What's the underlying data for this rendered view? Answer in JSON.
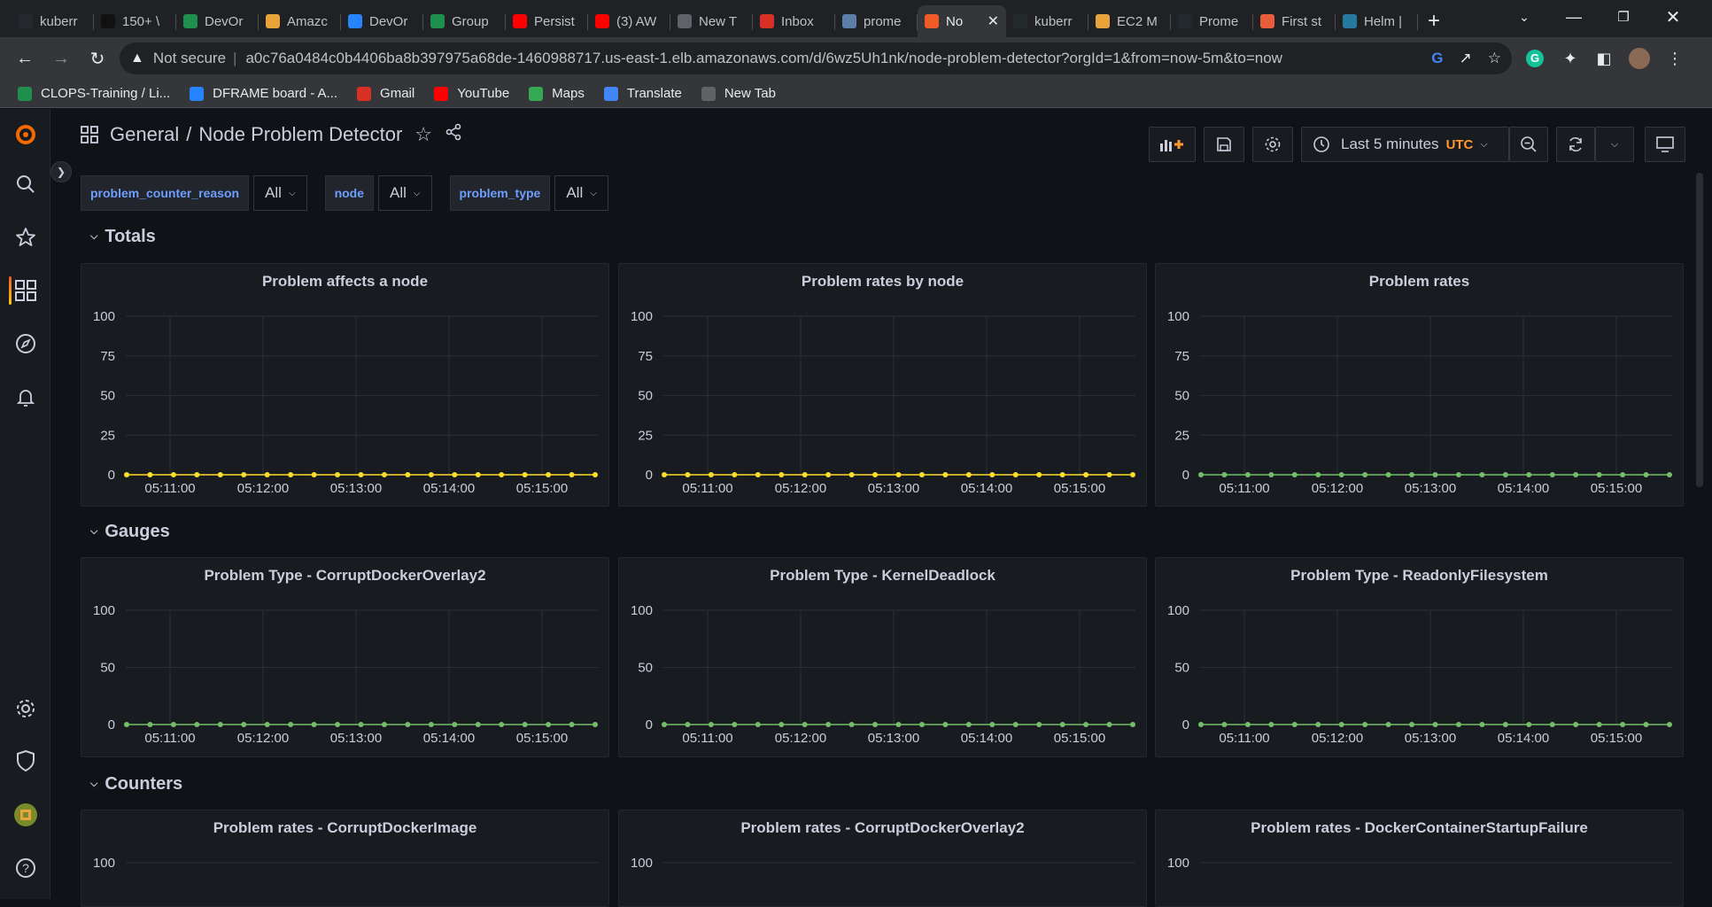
{
  "browser": {
    "tabs": [
      {
        "label": "kuberr",
        "icon": "github-icon",
        "color": "#24292e"
      },
      {
        "label": "150+ \\",
        "icon": "bb-icon",
        "color": "#111111"
      },
      {
        "label": "DevOr",
        "icon": "devops-icon",
        "color": "#1f8f4e"
      },
      {
        "label": "Amazc",
        "icon": "aws-box-icon",
        "color": "#e8a33b"
      },
      {
        "label": "DevOr",
        "icon": "jira-icon",
        "color": "#2684ff"
      },
      {
        "label": "Group",
        "icon": "devops-icon",
        "color": "#1f8f4e"
      },
      {
        "label": "Persist",
        "icon": "youtube-icon",
        "color": "#ff0000"
      },
      {
        "label": "(3) AW",
        "icon": "youtube-icon",
        "color": "#ff0000"
      },
      {
        "label": "New T",
        "icon": "chrome-icon",
        "color": "#5f6368"
      },
      {
        "label": "Inbox",
        "icon": "gmail-icon",
        "color": "#d93025"
      },
      {
        "label": "prome",
        "icon": "prometheus-icon",
        "color": "#5b7fa8"
      },
      {
        "label": "No",
        "icon": "grafana-icon",
        "color": "#f05a28",
        "active": true
      },
      {
        "label": "kuberr",
        "icon": "github-icon",
        "color": "#24292e"
      },
      {
        "label": "EC2 M",
        "icon": "aws-box-icon",
        "color": "#e8a33b"
      },
      {
        "label": "Prome",
        "icon": "github-icon",
        "color": "#24292e"
      },
      {
        "label": "First st",
        "icon": "medium-icon",
        "color": "#e85d3a"
      },
      {
        "label": "Helm |",
        "icon": "helm-icon",
        "color": "#277a9f"
      }
    ],
    "not_secure": "Not secure",
    "url": "a0c76a0484c0b4406ba8b397975a68de-1460988717.us-east-1.elb.amazonaws.com/d/6wz5Uh1nk/node-problem-detector?orgId=1&from=now-5m&to=now",
    "bookmarks": [
      {
        "label": "CLOPS-Training / Li...",
        "icon": "devops-icon",
        "color": "#1f8f4e"
      },
      {
        "label": "DFRAME board - A...",
        "icon": "jira-icon",
        "color": "#2684ff"
      },
      {
        "label": "Gmail",
        "icon": "gmail-icon",
        "color": "#d93025"
      },
      {
        "label": "YouTube",
        "icon": "youtube-icon",
        "color": "#ff0000"
      },
      {
        "label": "Maps",
        "icon": "maps-icon",
        "color": "#34a853"
      },
      {
        "label": "Translate",
        "icon": "translate-icon",
        "color": "#4285f4"
      },
      {
        "label": "New Tab",
        "icon": "chrome-icon",
        "color": "#5f6368"
      }
    ]
  },
  "dashboard": {
    "folder": "General",
    "title": "Node Problem Detector",
    "time_range": "Last 5 minutes",
    "timezone": "UTC",
    "variables": [
      {
        "name": "problem_counter_reason",
        "value": "All"
      },
      {
        "name": "node",
        "value": "All"
      },
      {
        "name": "problem_type",
        "value": "All"
      }
    ],
    "rows": [
      {
        "title": "Totals"
      },
      {
        "title": "Gauges"
      },
      {
        "title": "Counters"
      }
    ]
  },
  "colors": {
    "series_yellow": "#fade2a",
    "series_green": "#73bf69",
    "accent_blue": "#6e9fff",
    "utc_orange": "#ff9830"
  },
  "chart_data": [
    {
      "panel": "Problem affects a node",
      "type": "line",
      "x": [
        "05:11:00",
        "05:12:00",
        "05:13:00",
        "05:14:00",
        "05:15:00"
      ],
      "yticks": [
        0,
        25,
        50,
        75,
        100
      ],
      "ylim": [
        0,
        100
      ],
      "series": [
        {
          "color": "#fade2a",
          "values": [
            0,
            0,
            0,
            0,
            0,
            0,
            0,
            0,
            0,
            0,
            0,
            0,
            0,
            0,
            0,
            0,
            0,
            0,
            0,
            0,
            0
          ]
        }
      ]
    },
    {
      "panel": "Problem rates by node",
      "type": "line",
      "x": [
        "05:11:00",
        "05:12:00",
        "05:13:00",
        "05:14:00",
        "05:15:00"
      ],
      "yticks": [
        0,
        25,
        50,
        75,
        100
      ],
      "ylim": [
        0,
        100
      ],
      "series": [
        {
          "color": "#fade2a",
          "values": [
            0,
            0,
            0,
            0,
            0,
            0,
            0,
            0,
            0,
            0,
            0,
            0,
            0,
            0,
            0,
            0,
            0,
            0,
            0,
            0,
            0
          ]
        }
      ]
    },
    {
      "panel": "Problem rates",
      "type": "line",
      "x": [
        "05:11:00",
        "05:12:00",
        "05:13:00",
        "05:14:00",
        "05:15:00"
      ],
      "yticks": [
        0,
        25,
        50,
        75,
        100
      ],
      "ylim": [
        0,
        100
      ],
      "series": [
        {
          "color": "#73bf69",
          "values": [
            0,
            0,
            0,
            0,
            0,
            0,
            0,
            0,
            0,
            0,
            0,
            0,
            0,
            0,
            0,
            0,
            0,
            0,
            0,
            0,
            0
          ]
        }
      ]
    },
    {
      "panel": "Problem Type - CorruptDockerOverlay2",
      "type": "line",
      "x": [
        "05:11:00",
        "05:12:00",
        "05:13:00",
        "05:14:00",
        "05:15:00"
      ],
      "yticks": [
        0,
        50,
        100
      ],
      "ylim": [
        0,
        100
      ],
      "series": [
        {
          "color": "#73bf69",
          "values": [
            0,
            0,
            0,
            0,
            0,
            0,
            0,
            0,
            0,
            0,
            0,
            0,
            0,
            0,
            0,
            0,
            0,
            0,
            0,
            0,
            0
          ]
        }
      ]
    },
    {
      "panel": "Problem Type - KernelDeadlock",
      "type": "line",
      "x": [
        "05:11:00",
        "05:12:00",
        "05:13:00",
        "05:14:00",
        "05:15:00"
      ],
      "yticks": [
        0,
        50,
        100
      ],
      "ylim": [
        0,
        100
      ],
      "series": [
        {
          "color": "#73bf69",
          "values": [
            0,
            0,
            0,
            0,
            0,
            0,
            0,
            0,
            0,
            0,
            0,
            0,
            0,
            0,
            0,
            0,
            0,
            0,
            0,
            0,
            0
          ]
        }
      ]
    },
    {
      "panel": "Problem Type - ReadonlyFilesystem",
      "type": "line",
      "x": [
        "05:11:00",
        "05:12:00",
        "05:13:00",
        "05:14:00",
        "05:15:00"
      ],
      "yticks": [
        0,
        50,
        100
      ],
      "ylim": [
        0,
        100
      ],
      "series": [
        {
          "color": "#73bf69",
          "values": [
            0,
            0,
            0,
            0,
            0,
            0,
            0,
            0,
            0,
            0,
            0,
            0,
            0,
            0,
            0,
            0,
            0,
            0,
            0,
            0,
            0
          ]
        }
      ]
    },
    {
      "panel": "Problem rates - CorruptDockerImage",
      "type": "line",
      "yticks": [
        100
      ]
    },
    {
      "panel": "Problem rates - CorruptDockerOverlay2",
      "type": "line",
      "yticks": [
        100
      ]
    },
    {
      "panel": "Problem rates - DockerContainerStartupFailure",
      "type": "line",
      "yticks": [
        100
      ]
    }
  ]
}
